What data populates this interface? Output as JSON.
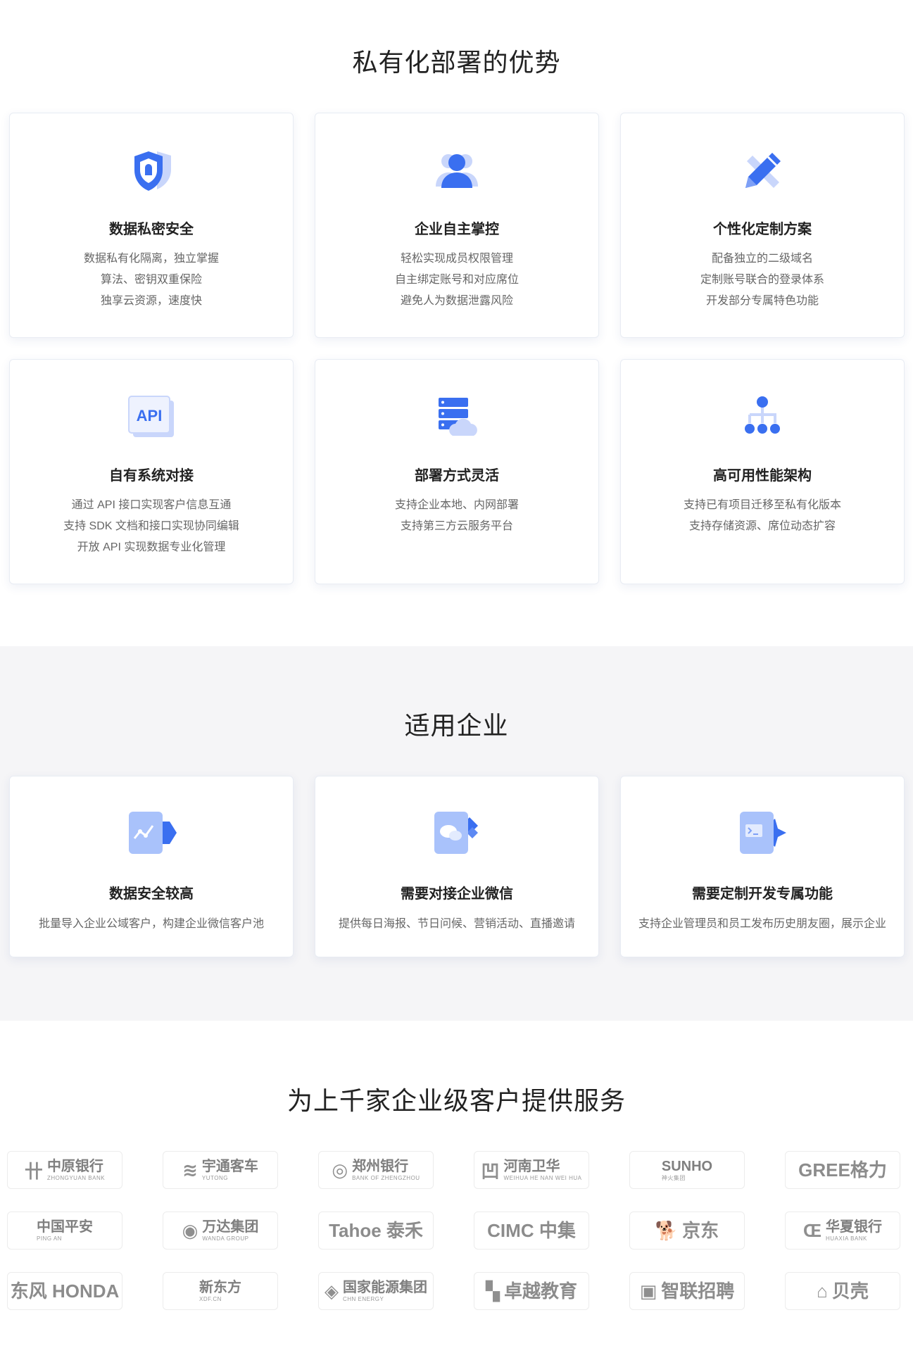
{
  "advantages": {
    "title": "私有化部署的优势",
    "cards": [
      {
        "icon": "shield-icon",
        "title": "数据私密安全",
        "lines": [
          "数据私有化隔离，独立掌握",
          "算法、密钥双重保险",
          "独享云资源，速度快"
        ]
      },
      {
        "icon": "user-icon",
        "title": "企业自主掌控",
        "lines": [
          "轻松实现成员权限管理",
          "自主绑定账号和对应席位",
          "避免人为数据泄露风险"
        ]
      },
      {
        "icon": "pencil-icon",
        "title": "个性化定制方案",
        "lines": [
          "配备独立的二级域名",
          "定制账号联合的登录体系",
          "开发部分专属特色功能"
        ]
      },
      {
        "icon": "api-icon",
        "title": "自有系统对接",
        "icon_text": "API",
        "lines": [
          "通过 API 接口实现客户信息互通",
          "支持 SDK 文档和接口实现协同编辑",
          "开放 API 实现数据专业化管理"
        ]
      },
      {
        "icon": "server-cloud-icon",
        "title": "部署方式灵活",
        "lines": [
          "支持企业本地、内网部署",
          "支持第三方云服务平台"
        ]
      },
      {
        "icon": "network-icon",
        "title": "高可用性能架构",
        "lines": [
          "支持已有项目迁移至私有化版本",
          "支持存储资源、席位动态扩容"
        ]
      }
    ]
  },
  "applicable": {
    "title": "适用企业",
    "cards": [
      {
        "icon": "data-chart-icon",
        "title": "数据安全较高",
        "desc": "批量导入企业公域客户，构建企业微信客户池"
      },
      {
        "icon": "chat-bubble-icon",
        "title": "需要对接企业微信",
        "desc": "提供每日海报、节日问候、营销活动、直播邀请"
      },
      {
        "icon": "terminal-icon",
        "title": "需要定制开发专属功能",
        "desc": "支持企业管理员和员工发布历史朋友圈，展示企业"
      }
    ]
  },
  "clients": {
    "title": "为上千家企业级客户提供服务",
    "logos": [
      {
        "mark": "卄",
        "main": "中原银行",
        "sub": "ZHONGYUAN BANK"
      },
      {
        "mark": "≋",
        "main": "宇通客车",
        "sub": "YUTONG"
      },
      {
        "mark": "◎",
        "main": "郑州银行",
        "sub": "BANK OF ZHENGZHOU"
      },
      {
        "mark": "凹",
        "main": "河南卫华",
        "sub": "WEIHUA  HE NAN WEI HUA"
      },
      {
        "mark": "",
        "main": "SUNHO",
        "sub": "神火集团"
      },
      {
        "mark": "",
        "main": "GREE格力",
        "sub": ""
      },
      {
        "mark": "",
        "main": "中国平安",
        "sub": "PING AN"
      },
      {
        "mark": "◉",
        "main": "万达集团",
        "sub": "WANDA GROUP"
      },
      {
        "mark": "",
        "main": "Tahoe 泰禾",
        "sub": ""
      },
      {
        "mark": "",
        "main": "CIMC 中集",
        "sub": ""
      },
      {
        "mark": "🐕",
        "main": "京东",
        "sub": ""
      },
      {
        "mark": "Œ",
        "main": "华夏银行",
        "sub": "HUAXIA BANK"
      },
      {
        "mark": "",
        "main": "东风 HONDA",
        "sub": ""
      },
      {
        "mark": "",
        "main": "新东方",
        "sub": "XDF.CN"
      },
      {
        "mark": "◈",
        "main": "国家能源集团",
        "sub": "CHN ENERGY"
      },
      {
        "mark": "▚",
        "main": "卓越教育",
        "sub": ""
      },
      {
        "mark": "▣",
        "main": "智联招聘",
        "sub": ""
      },
      {
        "mark": "⌂",
        "main": "贝壳",
        "sub": ""
      }
    ]
  }
}
